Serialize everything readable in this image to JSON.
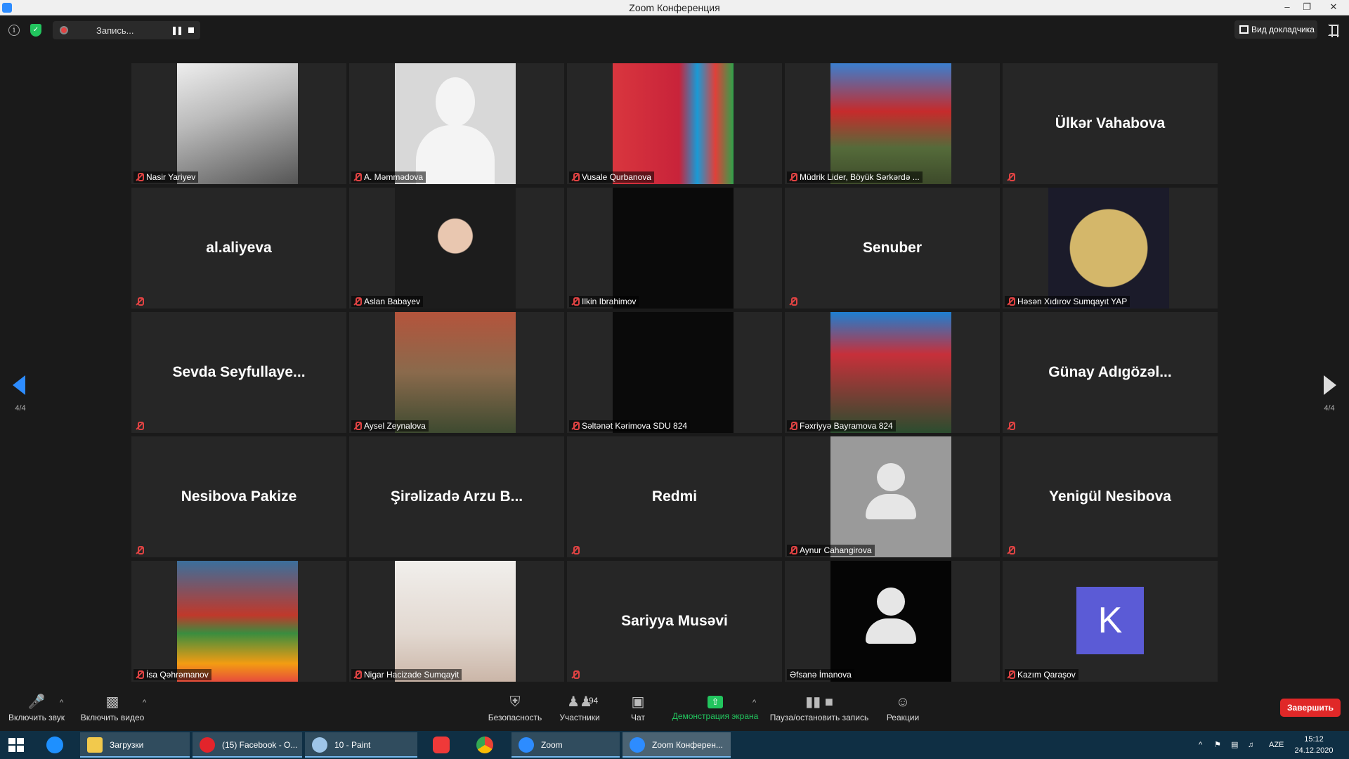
{
  "window": {
    "title": "Zoom Конференция"
  },
  "topbar": {
    "recording_label": "Запись...",
    "speaker_view_label": "Вид докладчика"
  },
  "nav": {
    "left_page": "4/4",
    "right_page": "4/4"
  },
  "participants": [
    {
      "name": "Nasir Yariyev",
      "type": "photo",
      "muted": true
    },
    {
      "name": "A. Məmmədova",
      "type": "photo",
      "muted": true
    },
    {
      "name": "Vusale Qurbanova",
      "type": "photo",
      "muted": true
    },
    {
      "name": "Müdrik Lider, Böyük Sərkərdə ...",
      "type": "photo",
      "muted": true
    },
    {
      "display": "Ülkər Vahabova",
      "type": "name",
      "muted": true
    },
    {
      "display": "al.aliyeva",
      "type": "name",
      "muted": true
    },
    {
      "name": "Aslan Babayev",
      "type": "photo",
      "muted": true
    },
    {
      "name": "Ilkin Ibrahimov",
      "type": "black",
      "muted": true
    },
    {
      "display": "Senuber",
      "type": "name",
      "muted": true
    },
    {
      "name": "Həsən Xıdırov Sumqayıt YAP",
      "type": "photo",
      "muted": true
    },
    {
      "display": "Sevda Seyfullaye...",
      "type": "name",
      "muted": true
    },
    {
      "name": "Aysel Zeynalova",
      "type": "photo",
      "muted": true
    },
    {
      "name": "Səltənət Kərimova SDU 824",
      "type": "black",
      "muted": true
    },
    {
      "name": "Fəxriyyə Bayramova 824",
      "type": "photo",
      "muted": true
    },
    {
      "display": "Günay Adıgözəl...",
      "type": "name",
      "muted": true
    },
    {
      "display": "Nesibova Pakize",
      "type": "name",
      "muted": true
    },
    {
      "display": "Şirəlizadə Arzu B...",
      "type": "name",
      "muted": false
    },
    {
      "display": "Redmi",
      "type": "name",
      "muted": true
    },
    {
      "name": "Aynur Cahangirova",
      "type": "silhouette-gray",
      "muted": true
    },
    {
      "display": "Yenigül Nesibova",
      "type": "name",
      "muted": true
    },
    {
      "name": "İsa Qəhrəmanov",
      "type": "photo",
      "muted": true
    },
    {
      "name": "Nigar Hacizade Sumqayit",
      "type": "photo",
      "muted": true
    },
    {
      "display": "Sariyya Musəvi",
      "type": "name",
      "muted": true
    },
    {
      "name": "Əfsanə İmanova",
      "type": "silhouette-black",
      "muted": false
    },
    {
      "name": "Kazım Qaraşov",
      "initial": "K",
      "type": "initial",
      "muted": true
    }
  ],
  "toolbar": {
    "audio_label": "Включить звук",
    "video_label": "Включить видео",
    "security_label": "Безопасность",
    "participants_label": "Участники",
    "participants_count": "94",
    "chat_label": "Чат",
    "share_label": "Демонстрация экрана",
    "record_label": "Пауза/остановить запись",
    "reactions_label": "Реакции",
    "end_label": "Завершить"
  },
  "taskbar": {
    "items": [
      "Загрузки",
      "(15) Facebook - O...",
      "10 - Paint",
      "Zoom",
      "Zoom Конферен..."
    ],
    "lang": "AZE",
    "time": "15:12",
    "date": "24.12.2020"
  },
  "colors": {
    "accent": "#2d8cff",
    "share_green": "#22c55e",
    "end_red": "#e02828",
    "mute_red": "#e04343",
    "avatar_purple": "#5b5bd6"
  }
}
